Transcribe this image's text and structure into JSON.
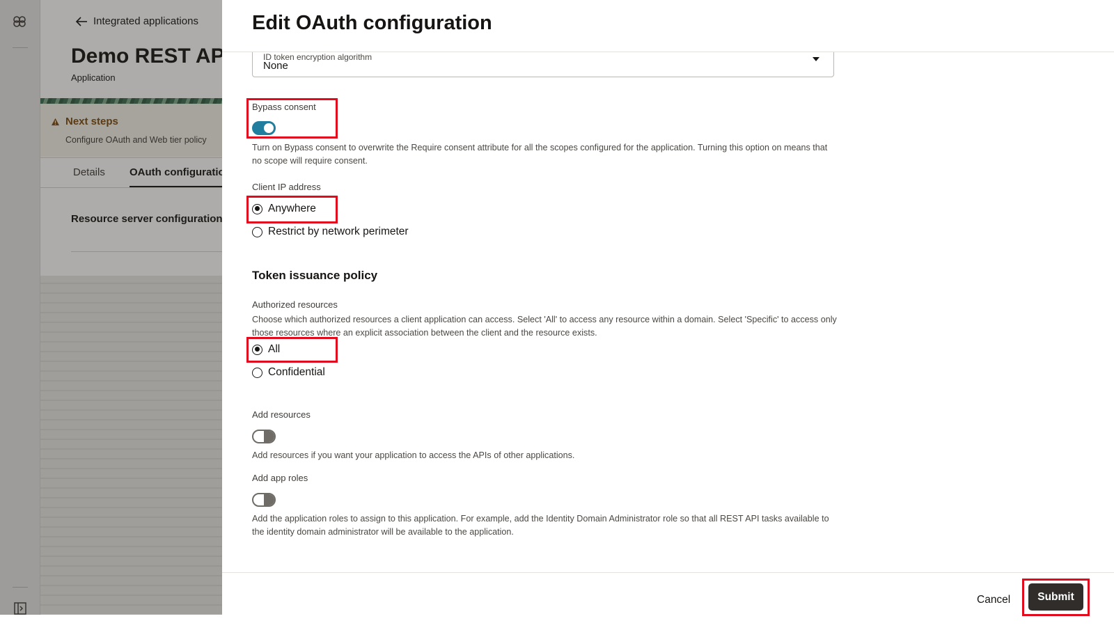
{
  "background_page": {
    "back_link": "Integrated applications",
    "app_title": "Demo REST API",
    "app_subtitle": "Application",
    "next_steps": {
      "title": "Next steps",
      "text": "Configure OAuth and Web tier policy"
    },
    "tabs": [
      {
        "label": "Details"
      },
      {
        "label": "OAuth configuration"
      }
    ],
    "section_title": "Resource server configuration"
  },
  "drawer": {
    "title": "Edit OAuth configuration",
    "id_token_select": {
      "label": "ID token encryption algorithm",
      "value": "None"
    },
    "bypass_consent": {
      "label": "Bypass consent",
      "enabled": true,
      "help": "Turn on Bypass consent to overwrite the Require consent attribute for all the scopes configured for the application. Turning this option on means that no scope will require consent."
    },
    "client_ip": {
      "label": "Client IP address",
      "options": [
        {
          "label": "Anywhere",
          "checked": true
        },
        {
          "label": "Restrict by network perimeter",
          "checked": false
        }
      ]
    },
    "token_policy": {
      "heading": "Token issuance policy",
      "authorized_resources": {
        "label": "Authorized resources",
        "help": "Choose which authorized resources a client application can access. Select 'All' to access any resource within a domain. Select 'Specific' to access only those resources where an explicit association between the client and the resource exists.",
        "options": [
          {
            "label": "All",
            "checked": true
          },
          {
            "label": "Confidential",
            "checked": false
          }
        ]
      },
      "add_resources": {
        "label": "Add resources",
        "enabled": false,
        "help": "Add resources if you want your application to access the APIs of other applications."
      },
      "add_app_roles": {
        "label": "Add app roles",
        "enabled": false,
        "help": "Add the application roles to assign to this application. For example, add the Identity Domain Administrator role so that all REST API tasks available to the identity domain administrator will be available to the application."
      }
    },
    "footer": {
      "cancel_label": "Cancel",
      "submit_label": "Submit"
    }
  },
  "colors": {
    "highlight": "#e00b1c",
    "switch_on": "#227e9e",
    "submit_bg": "#312d2a",
    "next_steps_text": "#7a4a0c"
  },
  "icons": [
    "oracle-cloud-icon",
    "arrow-left-icon",
    "warning-icon",
    "panel-toggle-icon",
    "chevron-down-icon"
  ]
}
